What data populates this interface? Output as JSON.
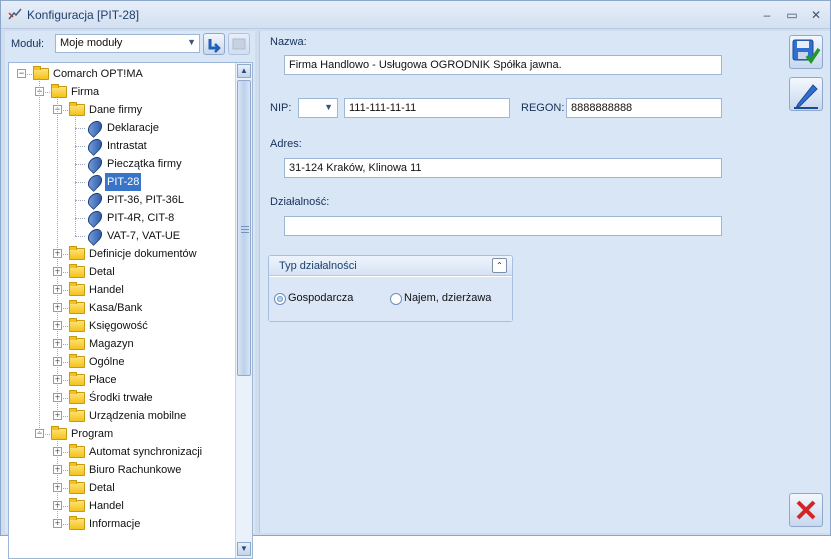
{
  "window": {
    "title": "Konfiguracja [PIT-28]"
  },
  "left": {
    "modul_label": "Moduł:",
    "modul_value": "Moje moduły",
    "tree": [
      {
        "label": "Comarch OPT!MA",
        "level": 0,
        "type": "folder",
        "expanded": true
      },
      {
        "label": "Firma",
        "level": 1,
        "type": "folder",
        "expanded": true
      },
      {
        "label": "Dane firmy",
        "level": 2,
        "type": "folder",
        "expanded": true
      },
      {
        "label": "Deklaracje",
        "level": 3,
        "type": "leaf"
      },
      {
        "label": "Intrastat",
        "level": 3,
        "type": "leaf"
      },
      {
        "label": "Pieczątka firmy",
        "level": 3,
        "type": "leaf"
      },
      {
        "label": "PIT-28",
        "level": 3,
        "type": "leaf",
        "selected": true
      },
      {
        "label": "PIT-36, PIT-36L",
        "level": 3,
        "type": "leaf"
      },
      {
        "label": "PIT-4R, CIT-8",
        "level": 3,
        "type": "leaf"
      },
      {
        "label": "VAT-7, VAT-UE",
        "level": 3,
        "type": "leaf"
      },
      {
        "label": "Definicje dokumentów",
        "level": 2,
        "type": "folder"
      },
      {
        "label": "Detal",
        "level": 2,
        "type": "folder"
      },
      {
        "label": "Handel",
        "level": 2,
        "type": "folder"
      },
      {
        "label": "Kasa/Bank",
        "level": 2,
        "type": "folder"
      },
      {
        "label": "Księgowość",
        "level": 2,
        "type": "folder"
      },
      {
        "label": "Magazyn",
        "level": 2,
        "type": "folder"
      },
      {
        "label": "Ogólne",
        "level": 2,
        "type": "folder"
      },
      {
        "label": "Płace",
        "level": 2,
        "type": "folder"
      },
      {
        "label": "Środki trwałe",
        "level": 2,
        "type": "folder"
      },
      {
        "label": "Urządzenia mobilne",
        "level": 2,
        "type": "folder"
      },
      {
        "label": "Program",
        "level": 1,
        "type": "folder",
        "expanded": true
      },
      {
        "label": "Automat synchronizacji",
        "level": 2,
        "type": "folder"
      },
      {
        "label": "Biuro Rachunkowe",
        "level": 2,
        "type": "folder"
      },
      {
        "label": "Detal",
        "level": 2,
        "type": "folder"
      },
      {
        "label": "Handel",
        "level": 2,
        "type": "folder"
      },
      {
        "label": "Informacje",
        "level": 2,
        "type": "folder"
      }
    ]
  },
  "form": {
    "nazwa_label": "Nazwa:",
    "nazwa_value": "Firma Handlowo - Usługowa OGRODNIK Spółka jawna.",
    "nip_label": "NIP:",
    "nip_prefix": "",
    "nip_value": "111-111-11-11",
    "regon_label": "REGON:",
    "regon_value": "8888888888",
    "adres_label": "Adres:",
    "adres_value": "31-124 Kraków, Klinowa 11",
    "dzialalnosc_label": "Działalność:",
    "dzialalnosc_value": "",
    "group": {
      "title": "Typ działalności",
      "options": [
        {
          "label": "Gospodarcza",
          "checked": true
        },
        {
          "label": "Najem, dzierżawa",
          "checked": false
        }
      ]
    }
  },
  "colors": {
    "selection": "#3874c8",
    "panel": "#d9e6f5",
    "border": "#9fb7d6"
  }
}
